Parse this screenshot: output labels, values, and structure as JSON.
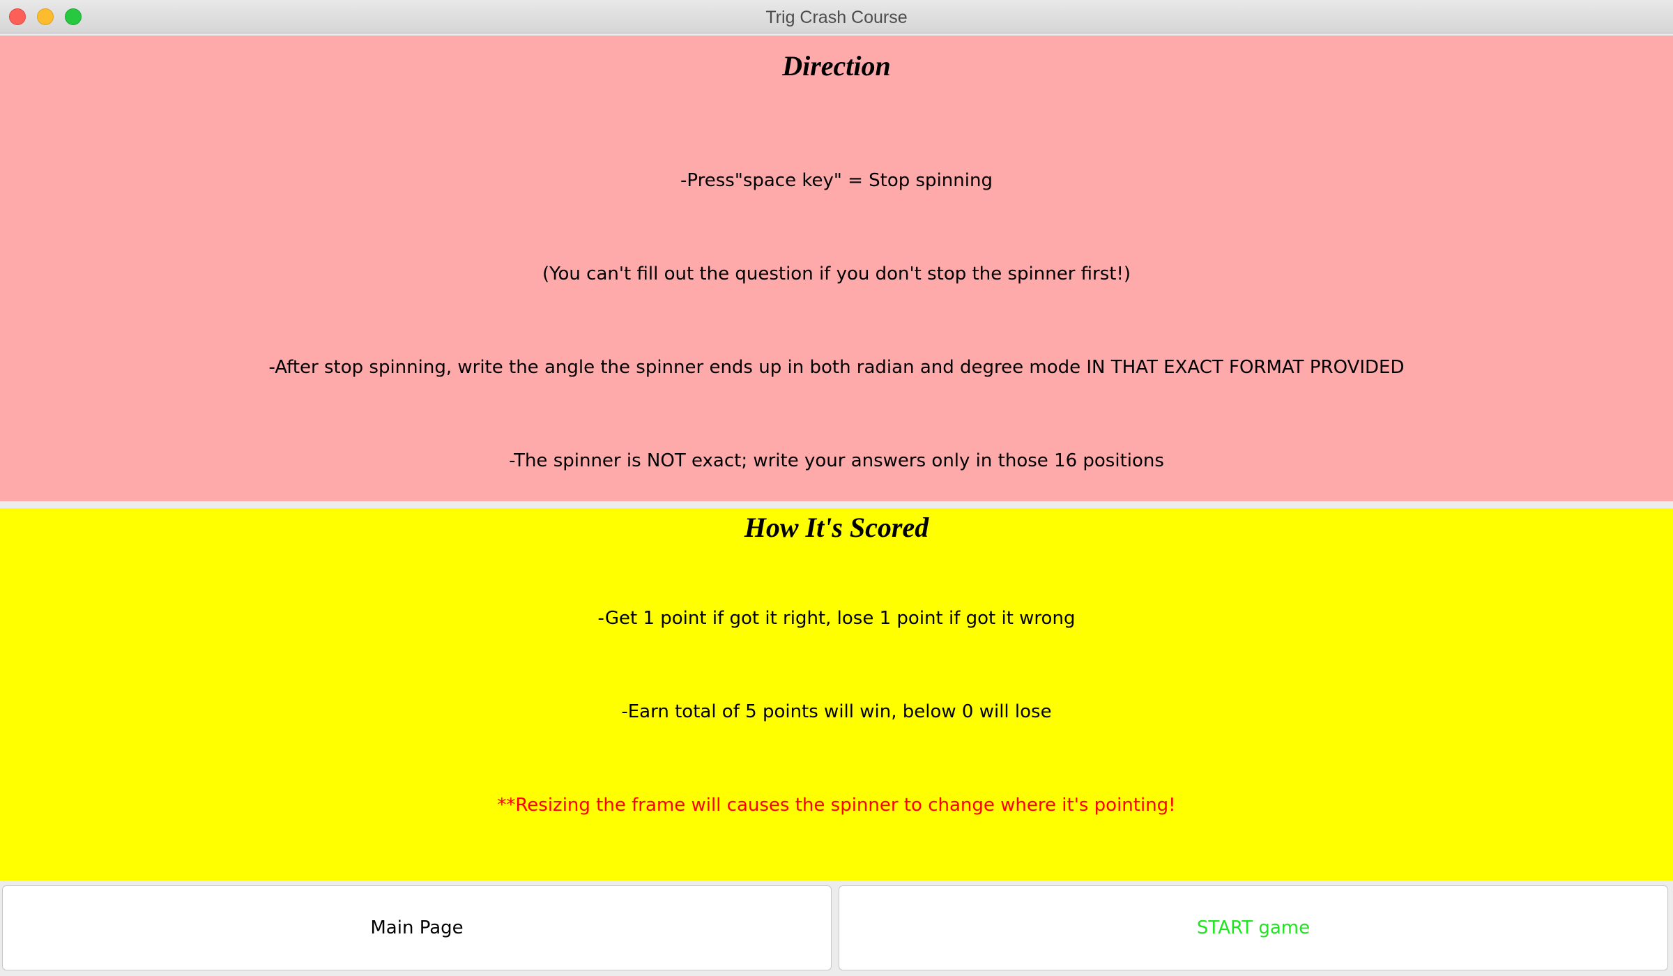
{
  "window": {
    "title": "Trig Crash Course"
  },
  "direction": {
    "heading": "Direction",
    "lines": [
      "-Press\"space key\" = Stop spinning",
      "(You can't fill out the question if you don't stop the spinner first!)",
      "-After stop spinning, write the angle the spinner ends up in both radian and degree mode IN THAT EXACT FORMAT PROVIDED",
      "-The spinner is NOT exact; write your answers only in those 16 positions"
    ]
  },
  "scoring": {
    "heading": "How It's Scored",
    "lines": [
      "-Get 1 point if got it right, lose 1 point if got it wrong",
      "-Earn total of 5 points will win, below 0 will lose",
      "**Resizing the frame will causes the spinner to change where it's pointing!"
    ]
  },
  "buttons": {
    "main_page": "Main Page",
    "start_game": "START game"
  },
  "colors": {
    "direction_bg": "#ffaaaa",
    "scoring_bg": "#ffff00",
    "warning_text": "#ff0000",
    "start_text": "#1ee61e"
  }
}
